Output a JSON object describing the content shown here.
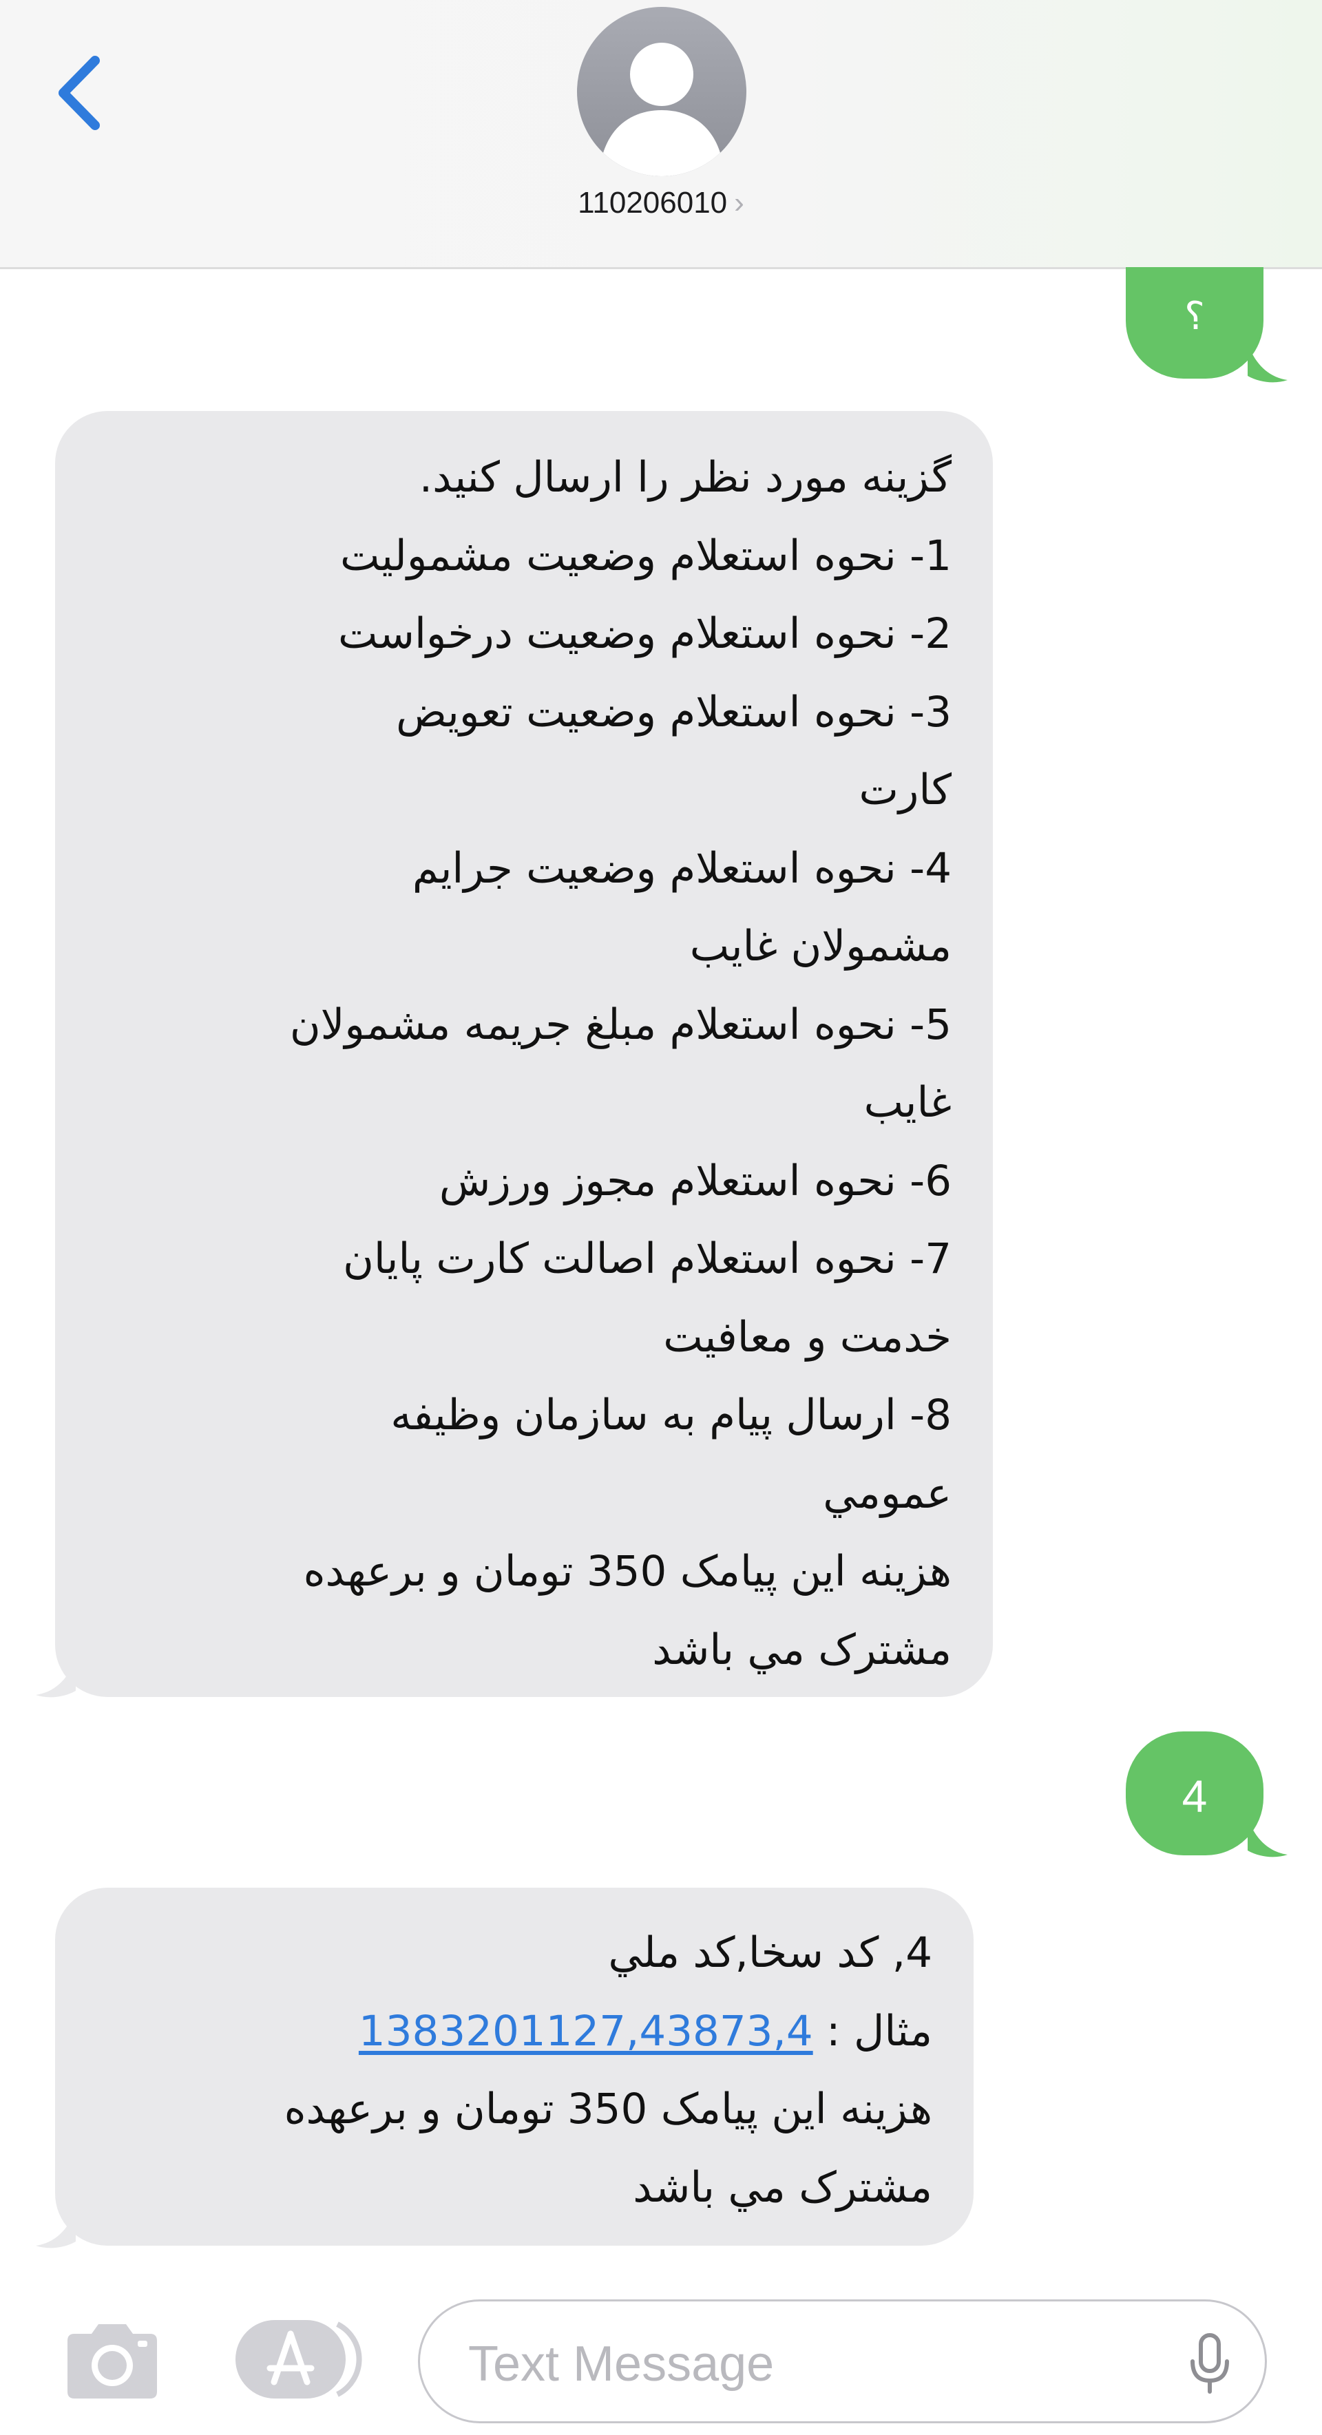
{
  "header": {
    "contact_number": "110206010",
    "chevron": "›"
  },
  "icons": {
    "back": "chevron-left-icon",
    "avatar": "person-silhouette-icon",
    "camera": "camera-icon",
    "apps": "app-store-icon",
    "mic": "microphone-icon"
  },
  "colors": {
    "accent_blue": "#2f7bdc",
    "sent_bubble": "#65c466",
    "received_bubble": "#e9e9eb"
  },
  "messages": [
    {
      "direction": "sent",
      "text": "؟"
    },
    {
      "direction": "received",
      "lines": [
        "گزینه مورد نظر را ارسال کنید.",
        "1- نحوه استعلام وضعیت مشمولیت",
        "2- نحوه استعلام وضعیت درخواست",
        "3- نحوه استعلام وضعیت تعویض",
        "کارت",
        "4- نحوه استعلام وضعیت جرایم",
        "مشمولان غایب",
        "5- نحوه استعلام مبلغ جریمه مشمولان",
        "غایب",
        "6- نحوه استعلام مجوز ورزش",
        "7- نحوه استعلام اصالت کارت پایان",
        "خدمت و معافیت",
        "8- ارسال پیام به سازمان وظیفه",
        "عمومي",
        "هزینه این پیامک 350 تومان و برعهده",
        "مشترک مي باشد"
      ]
    },
    {
      "direction": "sent",
      "text": "4"
    },
    {
      "direction": "received",
      "line1": "4, کد سخا,کد ملي",
      "example_prefix": "مثال : ",
      "example_link": "1383201127,43873,4",
      "line3": "هزینه این پیامک 350 تومان و برعهده",
      "line4": "مشترک مي باشد"
    }
  ],
  "composer": {
    "placeholder": "Text Message"
  }
}
